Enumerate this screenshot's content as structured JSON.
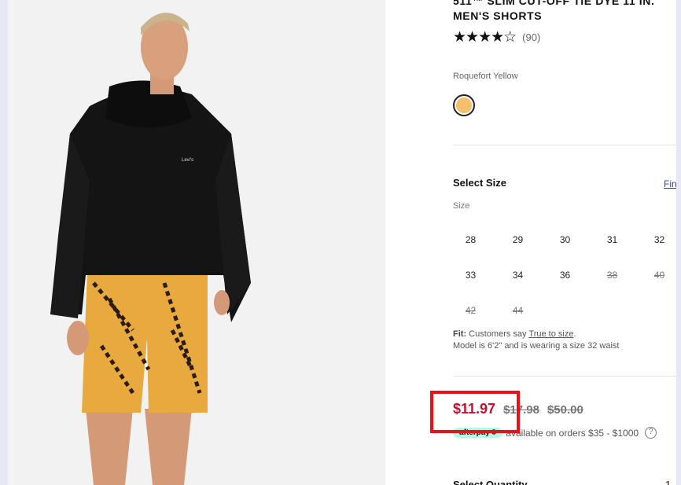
{
  "product": {
    "title": "511™ Slim Cut-Off Tie Dye 11 In. Men's Shorts",
    "stars": "★★★★☆",
    "review_count": "(90)"
  },
  "color": {
    "name": "Roquefort Yellow",
    "swatch_hex": "#f6bf6b"
  },
  "size": {
    "heading": "Select Size",
    "fit_link": "Find",
    "label": "Size",
    "options": [
      {
        "label": "28",
        "available": true
      },
      {
        "label": "29",
        "available": true
      },
      {
        "label": "30",
        "available": true
      },
      {
        "label": "31",
        "available": true
      },
      {
        "label": "32",
        "available": true
      },
      {
        "label": "33",
        "available": true
      },
      {
        "label": "34",
        "available": true
      },
      {
        "label": "36",
        "available": true
      },
      {
        "label": "38",
        "available": false
      },
      {
        "label": "40",
        "available": false
      },
      {
        "label": "42",
        "available": false
      },
      {
        "label": "44",
        "available": false
      }
    ]
  },
  "fit": {
    "prefix": "Fit:",
    "text": "Customers say",
    "link": "True to size",
    "period": ".",
    "model_note": "Model is 6'2\" and is wearing a size 32 waist"
  },
  "price": {
    "sale": "$11.97",
    "previous": "$17.98",
    "original": "$50.00",
    "sale_color": "#c41230"
  },
  "afterpay": {
    "badge": "afterpay⟲",
    "text": "available on orders $35 - $1000",
    "help_icon": "?"
  },
  "quantity": {
    "label": "Select Quantity",
    "value": "1"
  }
}
